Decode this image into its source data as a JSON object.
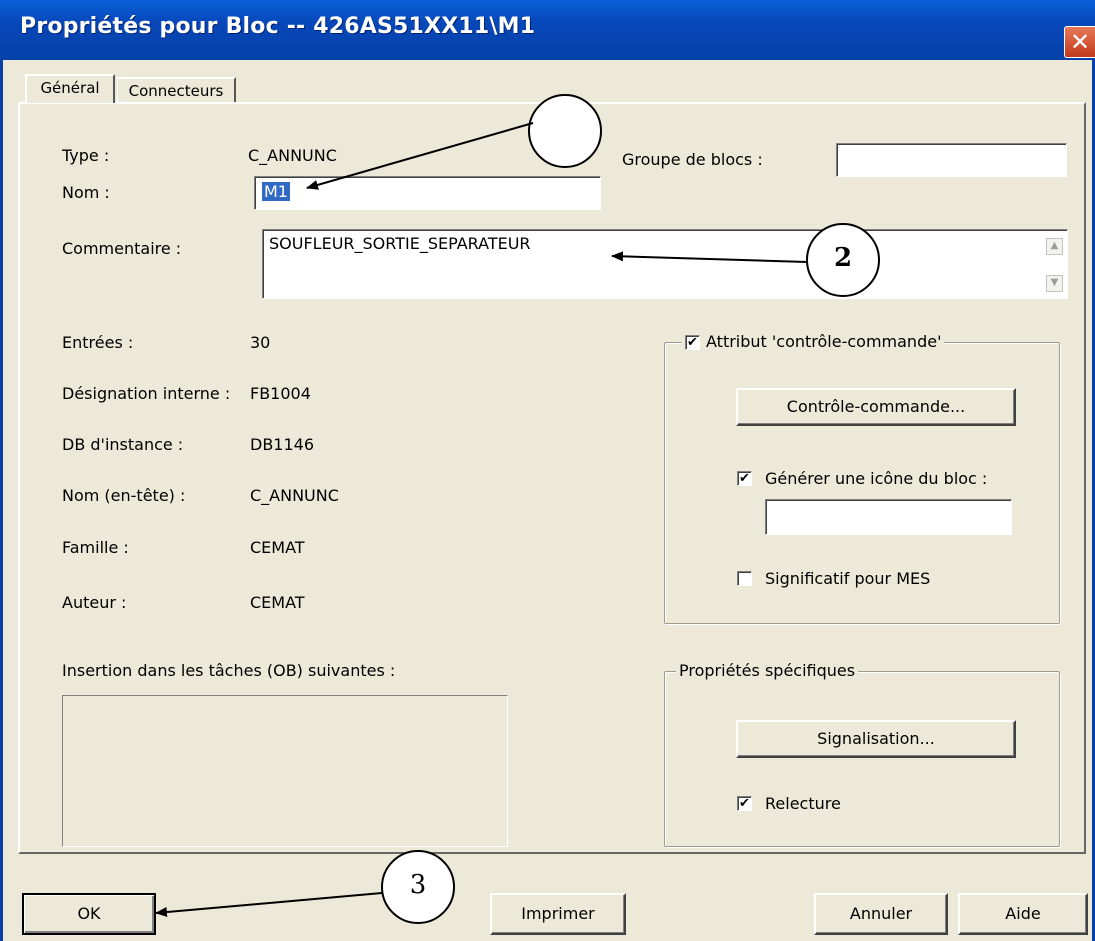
{
  "window": {
    "title": "Propriétés pour Bloc -- 426AS51XX11\\M1",
    "close_glyph": "✕"
  },
  "tabs": [
    {
      "label": "Général",
      "active": true
    },
    {
      "label": "Connecteurs",
      "active": false
    }
  ],
  "general": {
    "type_label": "Type :",
    "type_value": "C_ANNUNC",
    "nom_label": "Nom :",
    "nom_value": "M1",
    "groupe_label": "Groupe de blocs :",
    "groupe_value": "",
    "commentaire_label": "Commentaire :",
    "commentaire_value": "SOUFLEUR_SORTIE_SEPARATEUR",
    "entrees_label": "Entrées :",
    "entrees_value": "30",
    "designation_label": "Désignation interne :",
    "designation_value": "FB1004",
    "db_label": "DB d'instance :",
    "db_value": "DB1146",
    "nom_entete_label": "Nom (en-tête) :",
    "nom_entete_value": "C_ANNUNC",
    "famille_label": "Famille :",
    "famille_value": "CEMAT",
    "auteur_label": "Auteur :",
    "auteur_value": "CEMAT",
    "insertion_label": "Insertion dans les tâches (OB) suivantes :"
  },
  "controle_group": {
    "checkbox_label": "Attribut 'contrôle-commande'",
    "checked": true,
    "button_label": "Contrôle-commande...",
    "generer_label": "Générer une icône du bloc :",
    "generer_checked": true,
    "icone_value": "",
    "mes_label": "Significatif pour MES",
    "mes_checked": false
  },
  "specifiques_group": {
    "legend": "Propriétés spécifiques",
    "button_label": "Signalisation...",
    "relecture_label": "Relecture",
    "relecture_checked": true
  },
  "footer": {
    "ok_label": "OK",
    "print_label": "Imprimer",
    "cancel_label": "Annuler",
    "help_label": "Aide"
  },
  "check_glyph": "✔",
  "callouts": [
    "",
    "2",
    "3"
  ]
}
